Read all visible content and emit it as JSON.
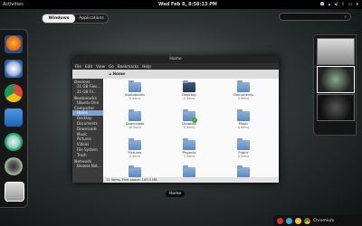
{
  "topbar": {
    "activities": "Activities",
    "clock": "Wed Feb 8, 8:58:13 PM"
  },
  "overview": {
    "tabs": [
      {
        "label": "Windows"
      },
      {
        "label": "Applications"
      }
    ],
    "search_placeholder": ""
  },
  "window": {
    "title": "Home",
    "menu": [
      "File",
      "Edit",
      "View",
      "Go",
      "Bookmarks",
      "Help"
    ],
    "location": "Home",
    "sidebar": {
      "devices_header": "Devices",
      "devices": [
        "21 GB Files...",
        "21 GB Fil..."
      ],
      "bookmarks_header": "Bookmarks",
      "bookmarks": [
        "Ubuntu One"
      ],
      "computer_header": "Computer",
      "computer": [
        "Home",
        "Desktop",
        "Documents",
        "Downloads",
        "Music",
        "Pictures",
        "Videos",
        "File System",
        "Trash"
      ],
      "network_header": "Network",
      "network": [
        "Browse Net..."
      ]
    },
    "files": [
      {
        "name": "Audiobooks",
        "sub": "0 items"
      },
      {
        "name": "Desktop",
        "sub": "2 items"
      },
      {
        "name": "Documents",
        "sub": "0 items"
      },
      {
        "name": "Downloads",
        "sub": "48 items"
      },
      {
        "name": "Dropbox",
        "sub": "8 items"
      },
      {
        "name": "Music",
        "sub": "0 items"
      },
      {
        "name": "Pictures",
        "sub": "0 items"
      },
      {
        "name": "Projects",
        "sub": "3 items"
      },
      {
        "name": "Public",
        "sub": "0 items"
      },
      {
        "name": "Templates",
        "sub": "0 items"
      },
      {
        "name": "Ubuntu One",
        "sub": "0 items"
      },
      {
        "name": "Videos",
        "sub": "0 items"
      }
    ],
    "status": "12 items, Free space: 109.3 MB"
  },
  "caption": "Home",
  "messagetray": {
    "label": "Chromium"
  }
}
